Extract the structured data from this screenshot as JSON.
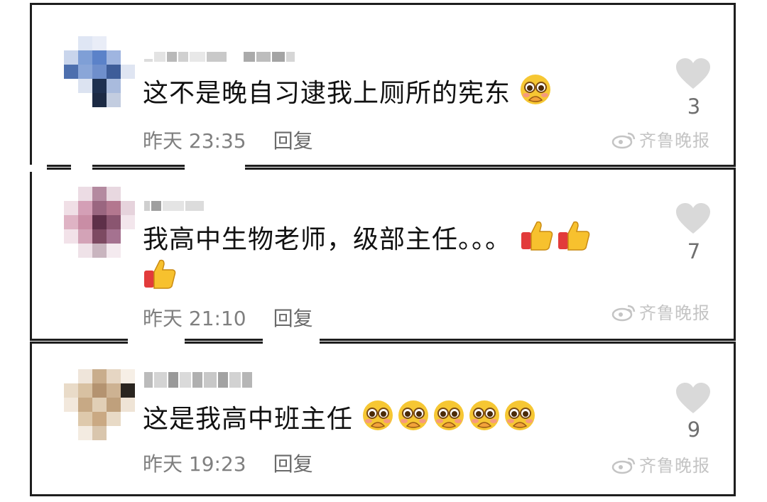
{
  "comments": [
    {
      "text": "这不是晚自习逮我上厕所的宪东",
      "emojis": [
        "pleading-emoji"
      ],
      "time": "昨天 23:35",
      "reply_label": "回复",
      "likes": "3",
      "watermark": "齐鲁晚报"
    },
    {
      "text_line1": "我高中生物老师，级部主任。。。",
      "emojis_line1": [
        "thumbs-up-emoji",
        "thumbs-up-emoji"
      ],
      "emojis_line2": [
        "thumbs-up-emoji"
      ],
      "time": "昨天 21:10",
      "reply_label": "回复",
      "likes": "7",
      "watermark": "齐鲁晚报"
    },
    {
      "text": "这是我高中班主任",
      "emojis": [
        "pleading-emoji",
        "pleading-emoji",
        "pleading-emoji",
        "pleading-emoji",
        "pleading-emoji"
      ],
      "time": "昨天 19:23",
      "reply_label": "回复",
      "likes": "9",
      "watermark": "齐鲁晚报"
    }
  ],
  "colors": {
    "border": "#1e1e1e",
    "meta_text": "#7f7f7f",
    "heart": "#d9d9d9",
    "watermark": "#c4c4c4"
  },
  "icons": {
    "like": "heart-icon",
    "watermark": "weibo-logo-icon"
  }
}
